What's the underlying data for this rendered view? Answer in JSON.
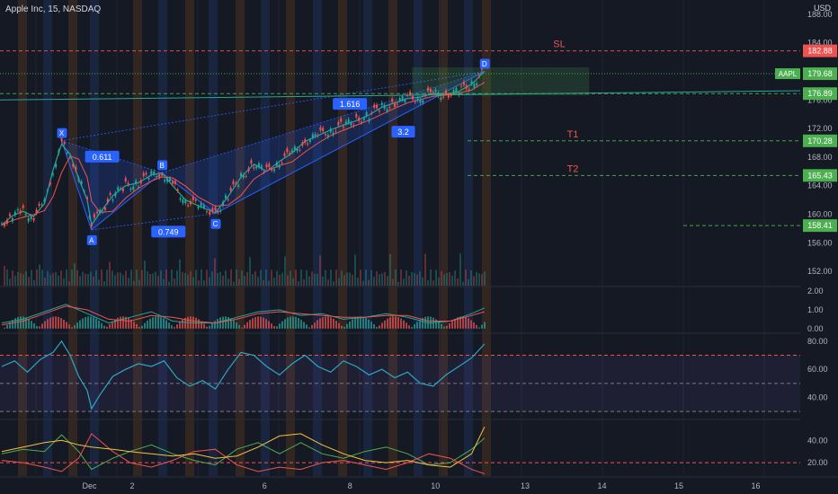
{
  "header": {
    "symbol_title": "Apple Inc, 15, NASDAQ",
    "currency": "USD"
  },
  "colors": {
    "background": "#151924",
    "grid": "#1f2433",
    "up": "#26a69a",
    "down": "#ef5350",
    "pattern_fill": "#2962ff",
    "sl_line": "#ef5350",
    "target_line": "#4caf50",
    "rsi_line": "#2aa8c4",
    "session_orange": "#b5651d",
    "session_blue": "#2f5bb7"
  },
  "chart_data": [
    {
      "type": "line",
      "pane": "price",
      "title": "",
      "price_axis_ticks": [
        "188.00",
        "184.00",
        "180.00",
        "176.00",
        "172.00",
        "168.00",
        "164.00",
        "160.00",
        "156.00",
        "152.00"
      ],
      "ylim": [
        150,
        190
      ],
      "price_tags": [
        {
          "label": "",
          "value": "182.88",
          "color": "#ef5350"
        },
        {
          "label": "AAPL",
          "value": "179.68",
          "color": "#4caf50"
        },
        {
          "label": "",
          "value": "176.89",
          "color": "#4caf50"
        },
        {
          "label": "",
          "value": "170.28",
          "color": "#4caf50"
        },
        {
          "label": "",
          "value": "165.43",
          "color": "#4caf50"
        },
        {
          "label": "",
          "value": "158.41",
          "color": "#4caf50"
        }
      ],
      "level_labels": [
        {
          "text": "SL",
          "price": 182.88
        },
        {
          "text": "T1",
          "price": 170.28
        },
        {
          "text": "T2",
          "price": 165.43
        }
      ],
      "harmonic_pattern": {
        "points": [
          {
            "label": "X",
            "x": 1.4,
            "price": 170.3
          },
          {
            "label": "A",
            "x": 2.1,
            "price": 157.8
          },
          {
            "label": "B",
            "x": 3.75,
            "price": 165.8
          },
          {
            "label": "C",
            "x": 5.0,
            "price": 160.1
          },
          {
            "label": "D",
            "x": 11.3,
            "price": 180.0
          }
        ],
        "ratios": [
          {
            "text": "0.611",
            "x": 2.35,
            "price": 168.0
          },
          {
            "text": "0.749",
            "x": 3.9,
            "price": 157.5
          },
          {
            "text": "1.616",
            "x": 8.15,
            "price": 175.4
          },
          {
            "text": "3.2",
            "x": 9.4,
            "price": 171.5
          }
        ]
      },
      "close_series": {
        "x": [
          0,
          0.25,
          0.5,
          0.75,
          1.0,
          1.2,
          1.4,
          1.6,
          1.8,
          2.0,
          2.1,
          2.3,
          2.6,
          2.9,
          3.2,
          3.5,
          3.75,
          4.0,
          4.3,
          4.6,
          5.0,
          5.3,
          5.6,
          5.9,
          6.2,
          6.5,
          6.8,
          7.1,
          7.4,
          7.7,
          8.0,
          8.3,
          8.6,
          8.9,
          9.2,
          9.5,
          9.8,
          10.1,
          10.4,
          10.7,
          11.0,
          11.3
        ],
        "y": [
          158.5,
          159.8,
          160.4,
          159.7,
          161.5,
          166.2,
          169.8,
          168.4,
          165.0,
          162.0,
          158.5,
          160.2,
          162.6,
          164.0,
          164.4,
          165.5,
          165.8,
          164.0,
          162.0,
          161.2,
          160.2,
          162.5,
          165.2,
          167.0,
          166.0,
          167.4,
          168.6,
          170.2,
          171.0,
          171.8,
          172.5,
          173.1,
          173.9,
          175.0,
          175.6,
          176.2,
          176.4,
          176.9,
          176.8,
          177.2,
          178.2,
          180.0
        ]
      },
      "x_axis_ticks": [
        {
          "label": "Dec",
          "x": 1.0
        },
        {
          "label": "2",
          "x": 2.0
        },
        {
          "label": "6",
          "x": 5.1
        },
        {
          "label": "8",
          "x": 7.1
        },
        {
          "label": "10",
          "x": 9.1
        },
        {
          "label": "13",
          "x": 11.2
        },
        {
          "label": "14",
          "x": 13.0
        },
        {
          "label": "15",
          "x": 14.8
        },
        {
          "label": "16",
          "x": 16.6
        }
      ]
    },
    {
      "type": "line",
      "pane": "oscillator",
      "title": "",
      "axis_ticks": [
        "2.00",
        "1.00",
        "0.00"
      ],
      "ylim": [
        -0.2,
        2.2
      ],
      "series": [
        {
          "color": "#26a69a",
          "x": [
            0,
            0.5,
            1.0,
            1.5,
            2.0,
            2.5,
            3.0,
            3.5,
            4.0,
            4.5,
            5.0,
            5.5,
            6.0,
            6.5,
            7.0,
            7.5,
            8.0,
            8.5,
            9.0,
            9.5,
            10.0,
            10.5,
            11.0,
            11.3
          ],
          "y": [
            0.3,
            0.5,
            0.9,
            1.3,
            0.8,
            0.3,
            0.6,
            0.9,
            0.4,
            0.3,
            0.3,
            0.6,
            0.9,
            1.0,
            0.7,
            0.8,
            0.5,
            0.6,
            0.8,
            0.6,
            0.3,
            0.4,
            0.8,
            1.1
          ]
        },
        {
          "color": "#ef5350",
          "x": [
            0,
            0.5,
            1.0,
            1.5,
            2.0,
            2.5,
            3.0,
            3.5,
            4.0,
            4.5,
            5.0,
            5.5,
            6.0,
            6.5,
            7.0,
            7.5,
            8.0,
            8.5,
            9.0,
            9.5,
            10.0,
            10.5,
            11.0,
            11.3
          ],
          "y": [
            0.2,
            0.4,
            0.8,
            1.2,
            1.0,
            0.5,
            0.4,
            0.7,
            0.6,
            0.4,
            0.3,
            0.5,
            0.8,
            0.9,
            0.8,
            0.7,
            0.6,
            0.6,
            0.7,
            0.7,
            0.4,
            0.4,
            0.7,
            0.9
          ]
        }
      ]
    },
    {
      "type": "line",
      "pane": "rsi",
      "title": "",
      "axis_ticks": [
        "80.00",
        "60.00",
        "40.00"
      ],
      "ylim": [
        25,
        85
      ],
      "reference_levels": [
        70,
        50,
        30
      ],
      "series": [
        {
          "color": "#2aa8c4",
          "x": [
            0,
            0.3,
            0.6,
            0.9,
            1.2,
            1.4,
            1.6,
            1.8,
            2.0,
            2.1,
            2.3,
            2.6,
            2.9,
            3.2,
            3.5,
            3.8,
            4.1,
            4.4,
            4.7,
            5.0,
            5.3,
            5.6,
            5.9,
            6.2,
            6.5,
            6.8,
            7.1,
            7.4,
            7.7,
            8.0,
            8.3,
            8.6,
            8.9,
            9.2,
            9.5,
            9.8,
            10.1,
            10.4,
            10.7,
            11.0,
            11.3
          ],
          "y": [
            62,
            66,
            58,
            67,
            72,
            80,
            70,
            55,
            45,
            32,
            42,
            55,
            60,
            64,
            62,
            66,
            54,
            48,
            52,
            46,
            60,
            72,
            70,
            62,
            56,
            64,
            70,
            62,
            58,
            66,
            62,
            56,
            60,
            54,
            58,
            50,
            48,
            56,
            62,
            68,
            78
          ]
        }
      ]
    },
    {
      "type": "line",
      "pane": "dmi",
      "title": "",
      "axis_ticks": [
        "40.00",
        "20.00"
      ],
      "ylim": [
        8,
        58
      ],
      "series": [
        {
          "color": "#4caf50",
          "x": [
            0,
            0.5,
            1.0,
            1.4,
            1.8,
            2.1,
            2.6,
            3.0,
            3.5,
            4.0,
            4.5,
            5.0,
            5.5,
            6.0,
            6.5,
            7.0,
            7.5,
            8.0,
            8.5,
            9.0,
            9.5,
            10.0,
            10.5,
            11.0,
            11.3
          ],
          "y": [
            28,
            32,
            30,
            45,
            30,
            14,
            24,
            30,
            36,
            28,
            22,
            18,
            32,
            38,
            28,
            38,
            28,
            24,
            30,
            34,
            28,
            18,
            20,
            32,
            42
          ]
        },
        {
          "color": "#ef5350",
          "x": [
            0,
            0.5,
            1.0,
            1.4,
            1.8,
            2.1,
            2.6,
            3.0,
            3.5,
            4.0,
            4.5,
            5.0,
            5.5,
            6.0,
            6.5,
            7.0,
            7.5,
            8.0,
            8.5,
            9.0,
            9.5,
            10.0,
            10.5,
            11.0,
            11.3
          ],
          "y": [
            22,
            20,
            16,
            12,
            24,
            46,
            30,
            20,
            16,
            22,
            30,
            32,
            18,
            12,
            16,
            14,
            20,
            22,
            18,
            14,
            20,
            28,
            24,
            14,
            10
          ]
        },
        {
          "color": "#f5c242",
          "x": [
            0,
            0.5,
            1.0,
            1.4,
            1.8,
            2.1,
            2.6,
            3.0,
            3.5,
            4.0,
            4.5,
            5.0,
            5.5,
            6.0,
            6.5,
            7.0,
            7.5,
            8.0,
            8.5,
            9.0,
            9.5,
            10.0,
            10.5,
            11.0,
            11.3
          ],
          "y": [
            30,
            34,
            38,
            40,
            36,
            34,
            32,
            30,
            28,
            26,
            28,
            24,
            26,
            34,
            44,
            46,
            36,
            28,
            22,
            20,
            22,
            18,
            16,
            28,
            52
          ]
        }
      ]
    }
  ]
}
